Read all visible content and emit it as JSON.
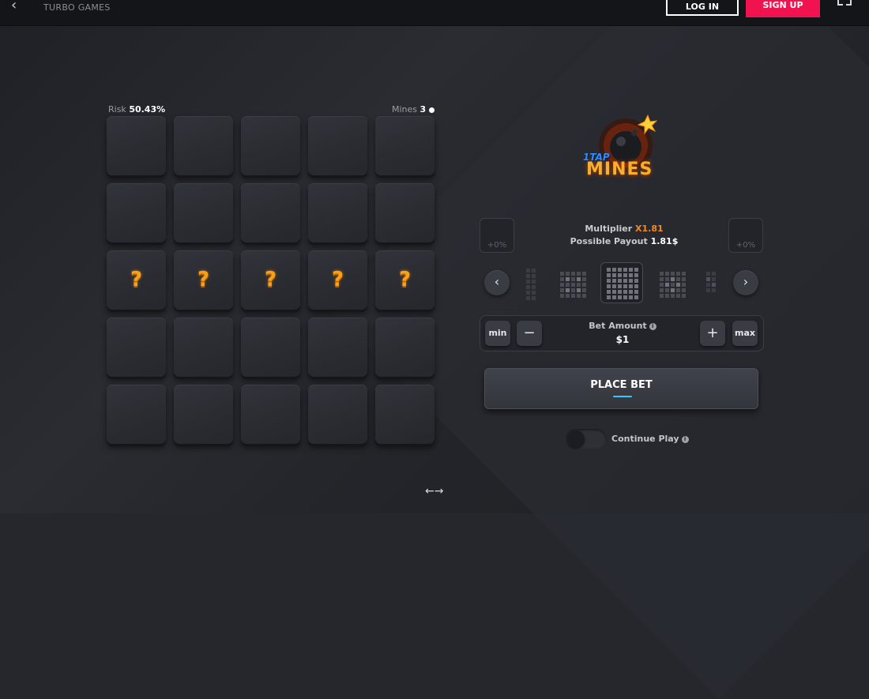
{
  "header": {
    "back_icon": "chevron-left-icon",
    "brand": "TURBO GAMES",
    "login_label": "LOG IN",
    "signup_label": "SIGN UP",
    "fullscreen_icon": "fullscreen-icon",
    "signup_color": "#f0134f"
  },
  "board": {
    "risk_label": "Risk",
    "risk_value": "50.43%",
    "mines_label": "Mines",
    "mines_value": "3",
    "question_mark": "?",
    "rows": [
      [
        "",
        "",
        "",
        "",
        ""
      ],
      [
        "",
        "",
        "",
        "",
        ""
      ],
      [
        "?",
        "?",
        "?",
        "?",
        "?"
      ],
      [
        "",
        "",
        "",
        "",
        ""
      ],
      [
        "",
        "",
        "",
        "",
        ""
      ]
    ],
    "question_color": "#f5a21a"
  },
  "logo": {
    "line1": "1TAP",
    "line2": "MINES"
  },
  "info": {
    "multiplier_label": "Multiplier",
    "multiplier_value": "X1.81",
    "payout_label": "Possible Payout",
    "payout_value": "1.81$",
    "left_bonus": "+0%",
    "right_bonus": "+0%",
    "highlight_color": "#f08a24"
  },
  "patterns": {
    "prev_icon": "chevron-left-icon",
    "next_icon": "chevron-right-icon"
  },
  "bet": {
    "min_label": "min",
    "minus_label": "−",
    "label": "Bet Amount",
    "info_icon": "info-icon",
    "value": "$1",
    "plus_label": "+",
    "max_label": "max"
  },
  "place_bet_label": "PLACE BET",
  "continue_play_label": "Continue Play",
  "footer": {
    "swap_icon": "swap-arrows-icon",
    "swap_glyph": "←→"
  }
}
